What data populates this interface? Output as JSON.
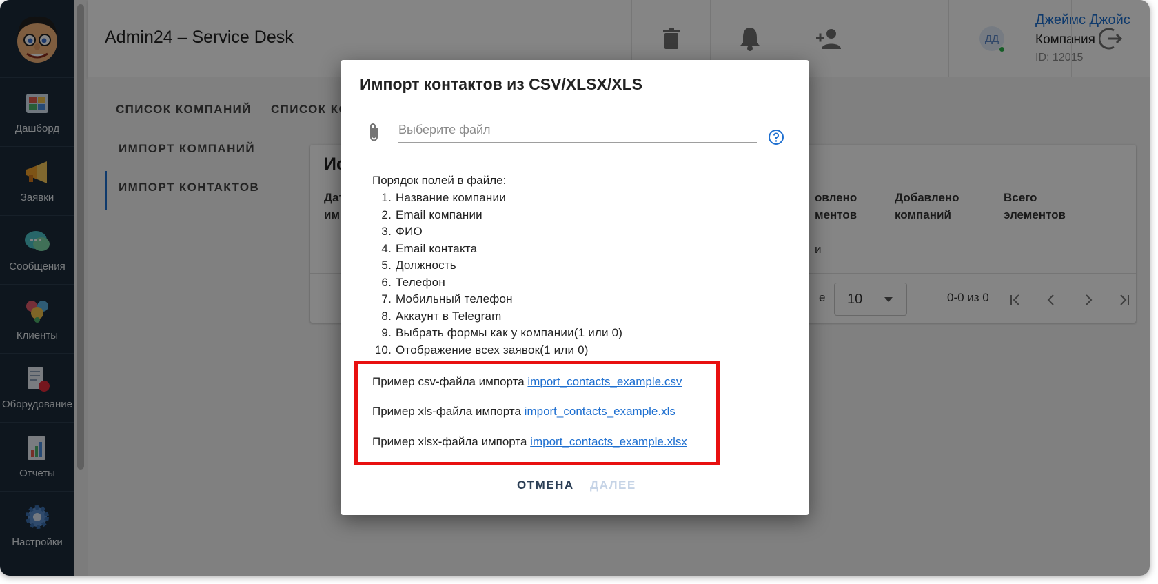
{
  "app": {
    "title": "Admin24 – Service Desk"
  },
  "sidebar": {
    "items": [
      {
        "label": "Дашборд",
        "icon": "dashboard-icon"
      },
      {
        "label": "Заявки",
        "icon": "megaphone-icon"
      },
      {
        "label": "Сообщения",
        "icon": "chat-icon"
      },
      {
        "label": "Клиенты",
        "icon": "clients-icon"
      },
      {
        "label": "Оборудование",
        "icon": "equipment-icon"
      },
      {
        "label": "Отчеты",
        "icon": "reports-icon"
      },
      {
        "label": "Настройки",
        "icon": "settings-icon"
      }
    ]
  },
  "user": {
    "initials": "ДД",
    "name": "Джеймс Джойс",
    "company": "Компания",
    "id": "ID: 12015"
  },
  "tabs": [
    "СПИСОК КОМПАНИЙ",
    "СПИСОК КО"
  ],
  "subnav": [
    "ИМПОРТ КОМПАНИЙ",
    "ИМПОРТ КОНТАКТОВ"
  ],
  "card": {
    "title": "Ис",
    "columns": [
      {
        "line1": "Дат",
        "line2": "имп"
      },
      {
        "line1": "овлено",
        "line2": "ментов"
      },
      {
        "line1": "Добавлено",
        "line2": "компаний"
      },
      {
        "line1": "Всего",
        "line2": "элементов"
      }
    ],
    "row_fragment": "и",
    "per_page_fragment": "е",
    "per_page": "10",
    "range": "0-0 из 0"
  },
  "dialog": {
    "title": "Импорт контактов из CSV/XLSX/XLS",
    "file_placeholder": "Выберите файл",
    "fields_title": "Порядок полей в файле:",
    "fields": [
      "Название компании",
      "Email компании",
      "ФИО",
      "Email контакта",
      "Должность",
      "Телефон",
      "Мобильный телефон",
      "Аккаунт в Telegram",
      "Выбрать формы как у компании(1 или 0)",
      "Отображение всех заявок(1 или 0)"
    ],
    "examples": [
      {
        "text": "Пример csv-файла импорта",
        "link": "import_contacts_example.csv"
      },
      {
        "text": "Пример xls-файла импорта",
        "link": "import_contacts_example.xls"
      },
      {
        "text": "Пример xlsx-файла импорта",
        "link": "import_contacts_example.xlsx"
      }
    ],
    "cancel_label": "ОТМЕНА",
    "next_label": "ДАЛЕЕ"
  },
  "colors": {
    "sidebar_bg": "#1b2b3b",
    "accent": "#1e6fd0",
    "highlight_border": "#e81010"
  }
}
